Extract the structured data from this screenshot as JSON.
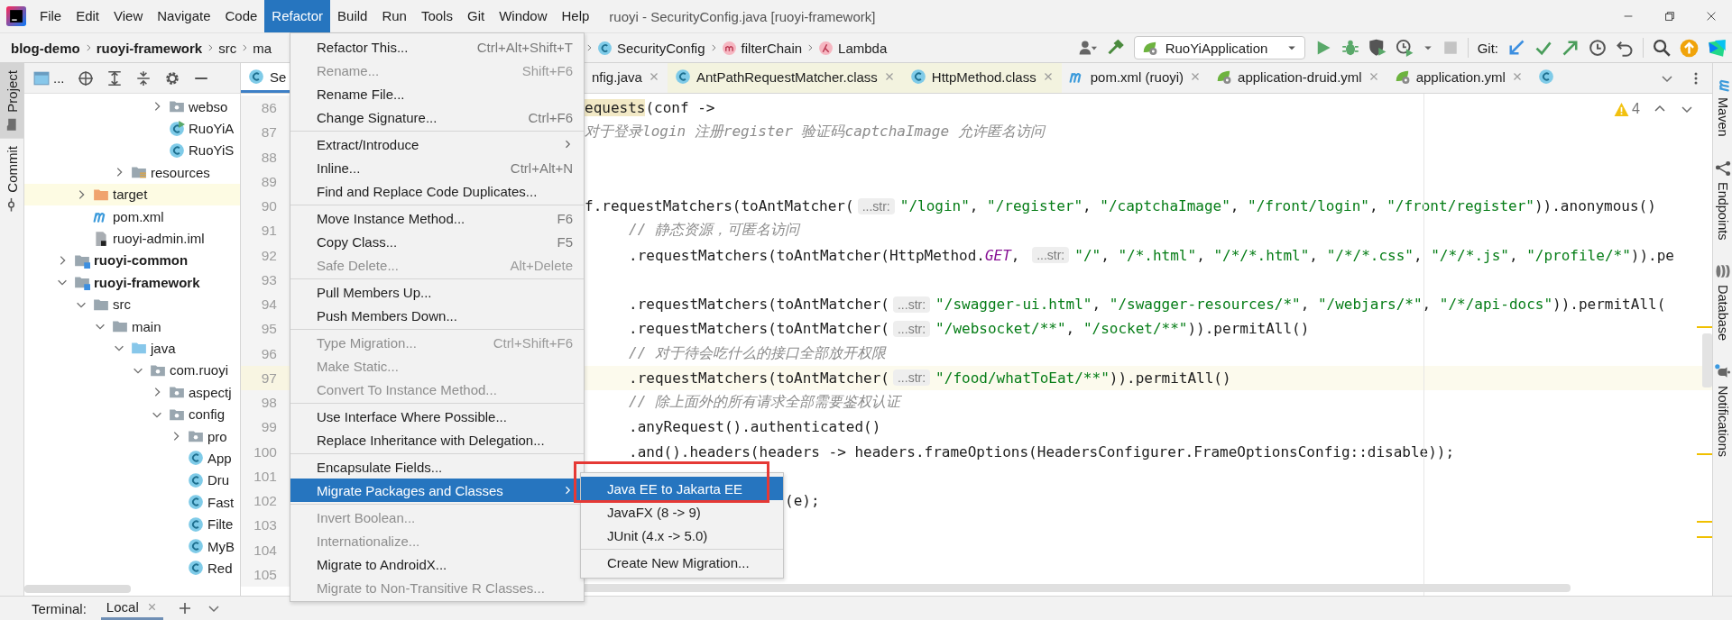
{
  "menubar": {
    "items": [
      {
        "label": "File",
        "selected": false
      },
      {
        "label": "Edit",
        "selected": false
      },
      {
        "label": "View",
        "selected": false
      },
      {
        "label": "Navigate",
        "selected": false
      },
      {
        "label": "Code",
        "selected": false
      },
      {
        "label": "Refactor",
        "selected": true
      },
      {
        "label": "Build",
        "selected": false
      },
      {
        "label": "Run",
        "selected": false
      },
      {
        "label": "Tools",
        "selected": false
      },
      {
        "label": "Git",
        "selected": false
      },
      {
        "label": "Window",
        "selected": false
      },
      {
        "label": "Help",
        "selected": false
      }
    ],
    "title": "ruoyi - SecurityConfig.java [ruoyi-framework]"
  },
  "navbar": {
    "breadcrumb_start": [
      {
        "label": "blog-demo",
        "kind": "module"
      },
      {
        "label": "ruoyi-framework",
        "kind": "module"
      },
      {
        "label": "src",
        "kind": "folder"
      },
      {
        "label": "ma",
        "kind": "folder"
      }
    ],
    "breadcrumb_end": [
      {
        "label": "SecurityConfig",
        "kind": "class"
      },
      {
        "label": "filterChain",
        "kind": "method"
      },
      {
        "label": "Lambda",
        "kind": "lambda"
      }
    ],
    "run_configuration": "RuoYiApplication",
    "git_label": "Git:"
  },
  "left_tool_tabs": [
    {
      "label": "Project",
      "selected": true
    },
    {
      "label": "Commit",
      "selected": false
    }
  ],
  "right_tool_tabs": [
    {
      "label": "Maven",
      "kind": "maven"
    },
    {
      "label": "Endpoints",
      "kind": "endpoints"
    },
    {
      "label": "Database",
      "kind": "database"
    },
    {
      "label": "Notifications",
      "kind": "notifications"
    }
  ],
  "project": {
    "view_label": "...",
    "tree": [
      {
        "children": [
          {
            "children": [
              {
                "children": [
                  {
                    "children": [
                      {
                        "children": [
                          {
                            "label": "webso",
                            "kind": "package",
                            "expanded": false
                          },
                          {
                            "label": "RuoYiA",
                            "kind": "class-run"
                          },
                          {
                            "label": "RuoYiS",
                            "kind": "class"
                          }
                        ]
                      }
                    ]
                  },
                  {
                    "label": "resources",
                    "kind": "resources",
                    "expanded": false
                  }
                ]
              }
            ]
          },
          {
            "label": "target",
            "kind": "excluded",
            "expanded": false
          },
          {
            "label": "pom.xml",
            "kind": "maven"
          },
          {
            "label": "ruoyi-admin.iml",
            "kind": "iml"
          }
        ]
      },
      {
        "label": "ruoyi-common",
        "kind": "module",
        "expanded": false
      },
      {
        "label": "ruoyi-framework",
        "kind": "module",
        "expanded": true,
        "children": [
          {
            "label": "src",
            "kind": "folder",
            "expanded": true,
            "children": [
              {
                "label": "main",
                "kind": "folder",
                "expanded": true,
                "children": [
                  {
                    "label": "java",
                    "kind": "source",
                    "expanded": true,
                    "children": [
                      {
                        "label": "com.ruoyi",
                        "kind": "package",
                        "expanded": true,
                        "children": [
                          {
                            "label": "aspectj",
                            "kind": "package",
                            "expanded": false
                          },
                          {
                            "label": "config",
                            "kind": "package",
                            "expanded": true,
                            "children": [
                              {
                                "label": "pro",
                                "kind": "package",
                                "expanded": false
                              },
                              {
                                "label": "App",
                                "kind": "class"
                              },
                              {
                                "label": "Dru",
                                "kind": "class"
                              },
                              {
                                "label": "Fast",
                                "kind": "class"
                              },
                              {
                                "label": "Filte",
                                "kind": "class"
                              },
                              {
                                "label": "MyB",
                                "kind": "class"
                              },
                              {
                                "label": "Red",
                                "kind": "class"
                              }
                            ]
                          }
                        ]
                      }
                    ]
                  }
                ]
              }
            ]
          }
        ]
      }
    ]
  },
  "editor": {
    "tabs": [
      {
        "label": "Se",
        "kind": "class",
        "selected": true
      },
      {
        "label": "nfig.java",
        "kind": "plain",
        "selected": false
      },
      {
        "label": "AntPathRequestMatcher.class",
        "kind": "library-class",
        "selected": false
      },
      {
        "label": "HttpMethod.class",
        "kind": "library-class",
        "selected": false
      },
      {
        "label": "pom.xml (ruoyi)",
        "kind": "maven",
        "selected": false
      },
      {
        "label": "application-druid.yml",
        "kind": "spring",
        "selected": false
      },
      {
        "label": "application.yml",
        "kind": "spring",
        "selected": false
      },
      {
        "kind": "class",
        "selected": false
      }
    ],
    "warnings": "4",
    "lines": [
      {
        "number": "86",
        "kind": "cut",
        "current": false,
        "segments": [
          {
            "kind": "match",
            "text": "equests"
          },
          {
            "kind": "plain",
            "text": "(conf ->"
          }
        ]
      },
      {
        "number": "87",
        "kind": "cut",
        "current": false,
        "segments": [
          {
            "kind": "comment",
            "text": "对于登录login 注册register 验证码captchaImage 允许匿名访问"
          }
        ]
      },
      {
        "number": "88",
        "kind": "blank",
        "current": false
      },
      {
        "number": "89",
        "kind": "blank",
        "current": false
      },
      {
        "number": "90",
        "kind": "cut",
        "current": false,
        "segments": [
          {
            "kind": "plain",
            "text": "f.requestMatchers(toAntMatcher("
          },
          {
            "kind": "hint",
            "text": "...str:"
          },
          {
            "kind": "string",
            "text": "\"/login\""
          },
          {
            "kind": "plain",
            "text": ", "
          },
          {
            "kind": "string",
            "text": "\"/register\""
          },
          {
            "kind": "plain",
            "text": ", "
          },
          {
            "kind": "string",
            "text": "\"/captchaImage\""
          },
          {
            "kind": "plain",
            "text": ", "
          },
          {
            "kind": "string",
            "text": "\"/front/login\""
          },
          {
            "kind": "plain",
            "text": ", "
          },
          {
            "kind": "string",
            "text": "\"/front/register\""
          },
          {
            "kind": "plain",
            "text": ")).anonymous()"
          }
        ]
      },
      {
        "number": "91",
        "kind": "indented",
        "current": false,
        "segments": [
          {
            "kind": "comment",
            "text": "// 静态资源，可匿名访问"
          }
        ]
      },
      {
        "number": "92",
        "kind": "indented",
        "current": false,
        "segments": [
          {
            "kind": "plain",
            "text": ".requestMatchers(toAntMatcher(HttpMethod."
          },
          {
            "kind": "constant",
            "text": "GET"
          },
          {
            "kind": "plain",
            "text": ", "
          },
          {
            "kind": "hint",
            "text": "...str:"
          },
          {
            "kind": "string",
            "text": "\"/\""
          },
          {
            "kind": "plain",
            "text": ", "
          },
          {
            "kind": "string",
            "text": "\"/*.html\""
          },
          {
            "kind": "plain",
            "text": ", "
          },
          {
            "kind": "string",
            "text": "\"/*/*.html\""
          },
          {
            "kind": "plain",
            "text": ", "
          },
          {
            "kind": "string",
            "text": "\"/*/*.css\""
          },
          {
            "kind": "plain",
            "text": ", "
          },
          {
            "kind": "string",
            "text": "\"/*/*.js\""
          },
          {
            "kind": "plain",
            "text": ", "
          },
          {
            "kind": "string",
            "text": "\"/profile/*\""
          },
          {
            "kind": "plain",
            "text": ")).pe"
          }
        ]
      },
      {
        "number": "93",
        "kind": "blank",
        "current": false
      },
      {
        "number": "94",
        "kind": "indented",
        "current": false,
        "segments": [
          {
            "kind": "plain",
            "text": ".requestMatchers(toAntMatcher("
          },
          {
            "kind": "hint",
            "text": "...str:"
          },
          {
            "kind": "string",
            "text": "\"/swagger-ui.html\""
          },
          {
            "kind": "plain",
            "text": ", "
          },
          {
            "kind": "string",
            "text": "\"/swagger-resources/*\""
          },
          {
            "kind": "plain",
            "text": ", "
          },
          {
            "kind": "string",
            "text": "\"/webjars/*\""
          },
          {
            "kind": "plain",
            "text": ", "
          },
          {
            "kind": "string",
            "text": "\"/*/api-docs\""
          },
          {
            "kind": "plain",
            "text": ")).permitAll("
          }
        ]
      },
      {
        "number": "95",
        "kind": "indented",
        "current": false,
        "segments": [
          {
            "kind": "plain",
            "text": ".requestMatchers(toAntMatcher("
          },
          {
            "kind": "hint",
            "text": "...str:"
          },
          {
            "kind": "string",
            "text": "\"/websocket/**\""
          },
          {
            "kind": "plain",
            "text": ", "
          },
          {
            "kind": "string",
            "text": "\"/socket/**\""
          },
          {
            "kind": "plain",
            "text": ")).permitAll()"
          }
        ]
      },
      {
        "number": "96",
        "kind": "indented",
        "current": false,
        "segments": [
          {
            "kind": "comment",
            "text": "// 对于待会吃什么的接口全部放开权限"
          }
        ]
      },
      {
        "number": "97",
        "kind": "indented",
        "current": true,
        "segments": [
          {
            "kind": "plain",
            "text": ".requestMatchers(toAntMatcher("
          },
          {
            "kind": "hint",
            "text": "...str:"
          },
          {
            "kind": "string",
            "text": "\"/food/whatToEat/**\""
          },
          {
            "kind": "plain",
            "text": ")).permitAll()"
          }
        ]
      },
      {
        "number": "98",
        "kind": "indented",
        "current": false,
        "segments": [
          {
            "kind": "comment",
            "text": "// 除上面外的所有请求全部需要鉴权认证"
          }
        ]
      },
      {
        "number": "99",
        "kind": "indented",
        "current": false,
        "segments": [
          {
            "kind": "plain",
            "text": ".anyRequest().authenticated()"
          }
        ]
      },
      {
        "number": "100",
        "kind": "indented",
        "current": false,
        "segments": [
          {
            "kind": "plain",
            "text": ".and().headers(headers -> headers.frameOptions(HeadersConfigurer.FrameOptionsConfig::disable));"
          }
        ]
      },
      {
        "number": "101",
        "kind": "blank",
        "current": false
      },
      {
        "number": "102",
        "kind": "after-popup",
        "current": false,
        "segments": [
          {
            "kind": "plain",
            "text": "(e);"
          }
        ]
      },
      {
        "number": "103",
        "kind": "blank",
        "current": false
      },
      {
        "number": "104",
        "kind": "blank",
        "current": false
      },
      {
        "number": "105",
        "kind": "blank",
        "current": false
      }
    ]
  },
  "refactor_menu": {
    "groups": [
      {
        "items": [
          {
            "label": "Refactor This...",
            "shortcut": "Ctrl+Alt+Shift+T",
            "disabled": false,
            "selected": false,
            "submenu": false
          },
          {
            "label": "Rename...",
            "shortcut": "Shift+F6",
            "disabled": true,
            "selected": false,
            "submenu": false
          },
          {
            "label": "Rename File...",
            "disabled": false,
            "selected": false,
            "submenu": false
          },
          {
            "label": "Change Signature...",
            "shortcut": "Ctrl+F6",
            "disabled": false,
            "selected": false,
            "submenu": false
          }
        ]
      },
      {
        "items": [
          {
            "label": "Extract/Introduce",
            "disabled": false,
            "selected": false,
            "submenu": true
          },
          {
            "label": "Inline...",
            "shortcut": "Ctrl+Alt+N",
            "disabled": false,
            "selected": false,
            "submenu": false
          },
          {
            "label": "Find and Replace Code Duplicates...",
            "disabled": false,
            "selected": false,
            "submenu": false
          }
        ]
      },
      {
        "items": [
          {
            "label": "Move Instance Method...",
            "shortcut": "F6",
            "disabled": false,
            "selected": false,
            "submenu": false
          },
          {
            "label": "Copy Class...",
            "shortcut": "F5",
            "disabled": false,
            "selected": false,
            "submenu": false
          },
          {
            "label": "Safe Delete...",
            "shortcut": "Alt+Delete",
            "disabled": true,
            "selected": false,
            "submenu": false
          }
        ]
      },
      {
        "items": [
          {
            "label": "Pull Members Up...",
            "disabled": false,
            "selected": false,
            "submenu": false
          },
          {
            "label": "Push Members Down...",
            "disabled": false,
            "selected": false,
            "submenu": false
          }
        ]
      },
      {
        "items": [
          {
            "label": "Type Migration...",
            "shortcut": "Ctrl+Shift+F6",
            "disabled": true,
            "selected": false,
            "submenu": false
          },
          {
            "label": "Make Static...",
            "disabled": true,
            "selected": false,
            "submenu": false
          },
          {
            "label": "Convert To Instance Method...",
            "disabled": true,
            "selected": false,
            "submenu": false
          }
        ]
      },
      {
        "items": [
          {
            "label": "Use Interface Where Possible...",
            "disabled": false,
            "selected": false,
            "submenu": false
          },
          {
            "label": "Replace Inheritance with Delegation...",
            "disabled": false,
            "selected": false,
            "submenu": false
          }
        ]
      },
      {
        "items": [
          {
            "label": "Encapsulate Fields...",
            "disabled": false,
            "selected": false,
            "submenu": false
          },
          {
            "label": "Migrate Packages and Classes",
            "disabled": false,
            "selected": true,
            "submenu": true
          }
        ]
      },
      {
        "items": [
          {
            "label": "Invert Boolean...",
            "disabled": true,
            "selected": false,
            "submenu": false
          },
          {
            "label": "Internationalize...",
            "disabled": true,
            "selected": false,
            "submenu": false
          },
          {
            "label": "Migrate to AndroidX...",
            "disabled": false,
            "selected": false,
            "submenu": false
          },
          {
            "label": "Migrate to Non-Transitive R Classes...",
            "disabled": true,
            "selected": false,
            "submenu": false
          }
        ]
      }
    ]
  },
  "migrate_submenu": {
    "groups": [
      {
        "items": [
          {
            "label": "Java EE to Jakarta EE",
            "selected": true
          },
          {
            "label": "JavaFX (8 -> 9)",
            "selected": false
          },
          {
            "label": "JUnit (4.x -> 5.0)",
            "selected": false
          }
        ]
      },
      {
        "items": [
          {
            "label": "Create New Migration...",
            "selected": false
          }
        ]
      }
    ]
  },
  "terminal": {
    "title": "Terminal:",
    "tabs": [
      {
        "label": "Local",
        "selected": true
      }
    ]
  }
}
